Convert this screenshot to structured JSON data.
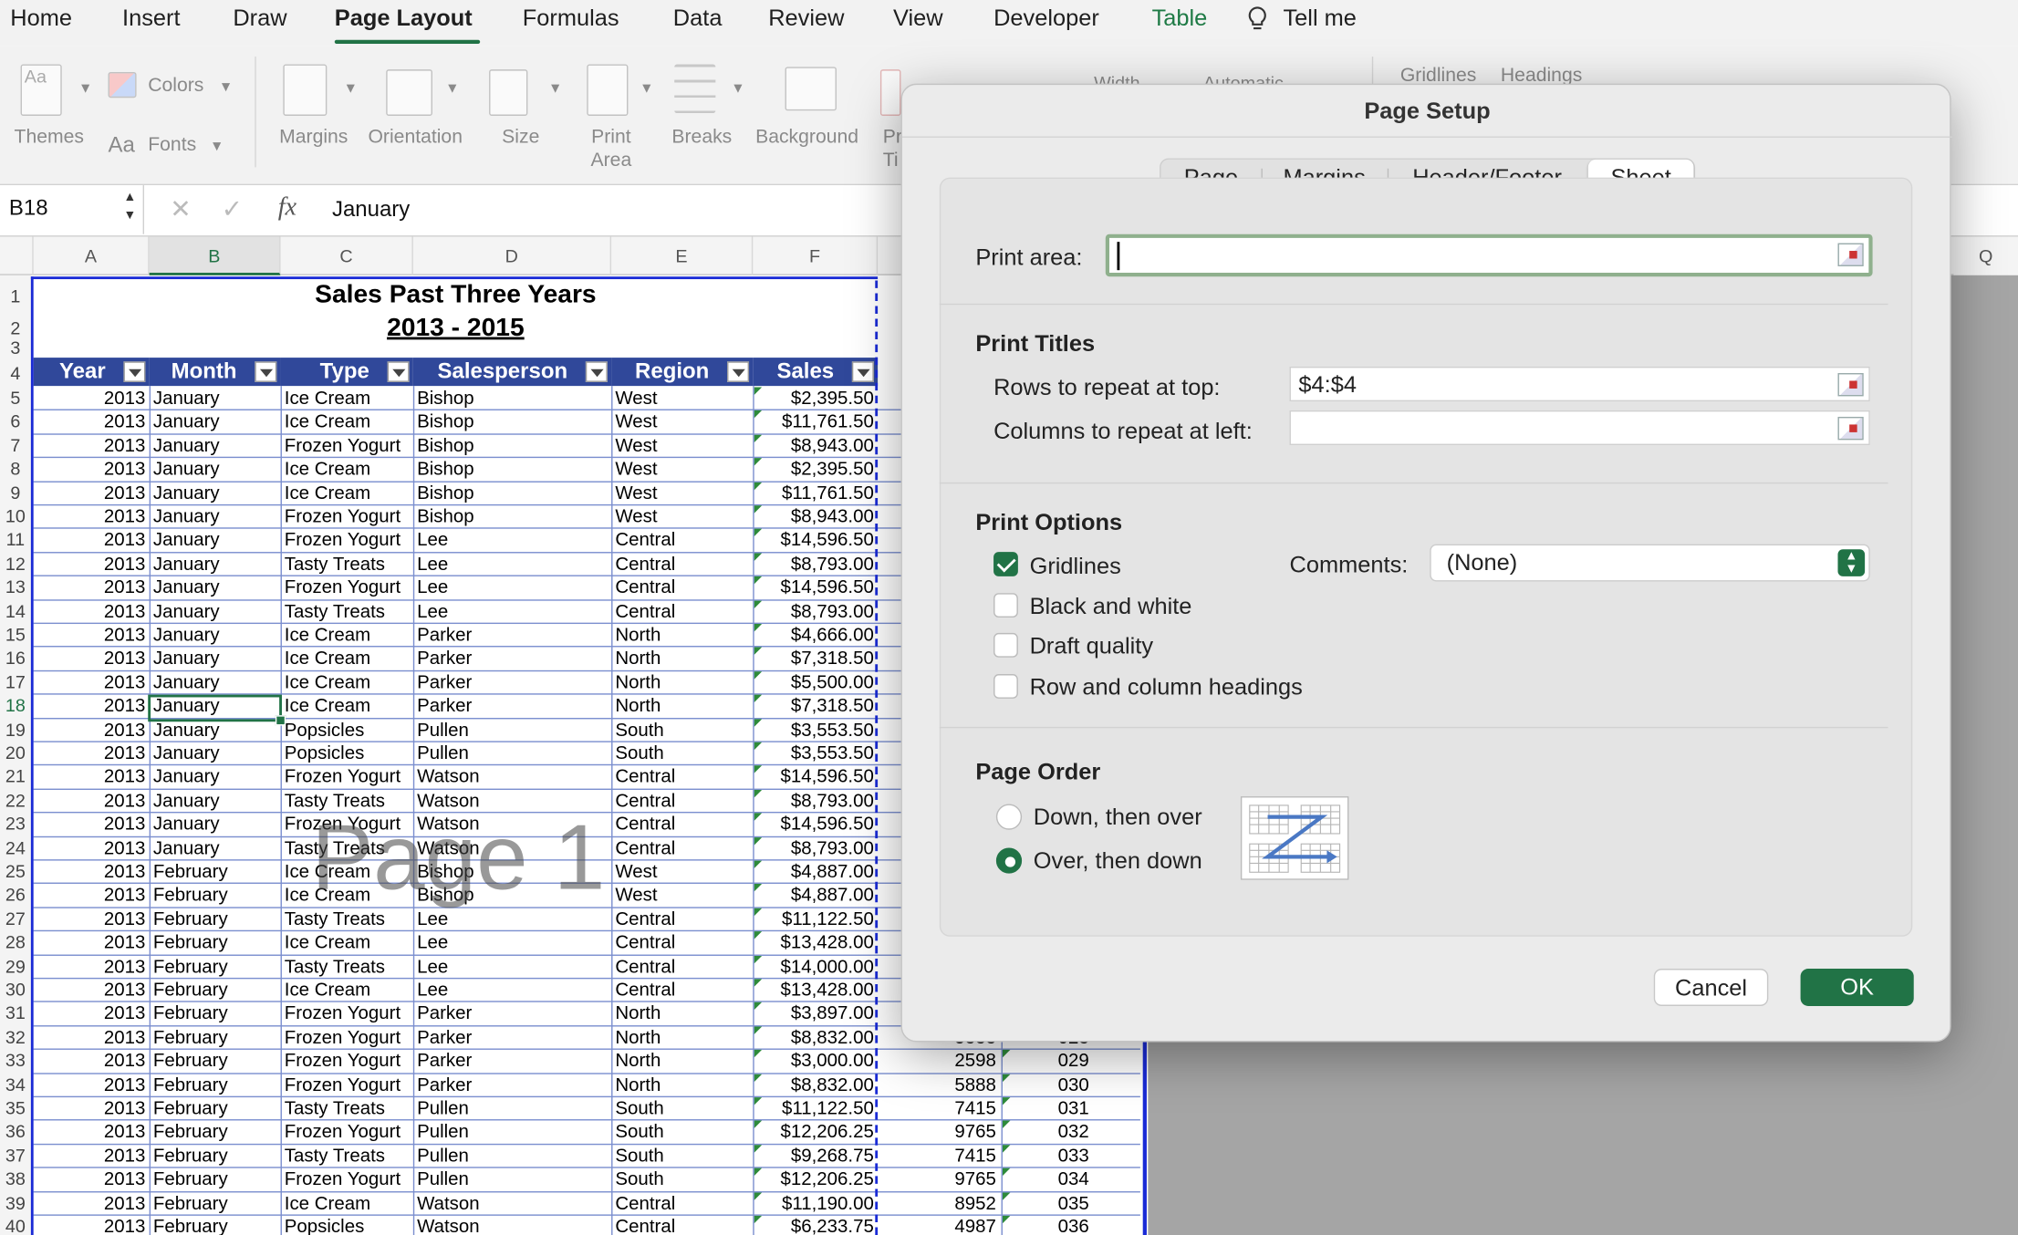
{
  "menu": {
    "tabs": [
      "Home",
      "Insert",
      "Draw",
      "Page Layout",
      "Formulas",
      "Data",
      "Review",
      "View",
      "Developer",
      "Table",
      "Tell me"
    ],
    "active": "Page Layout"
  },
  "ribbon": {
    "themes": "Themes",
    "colors": "Colors",
    "fonts": "Fonts",
    "fonts_glyph": "Aa",
    "margins": "Margins",
    "orientation": "Orientation",
    "size": "Size",
    "print_area": "Print\nArea",
    "breaks": "Breaks",
    "background": "Background",
    "print_titles_partial": "Pr\nTi",
    "width_partial": "Width",
    "automatic_partial": "Automatic",
    "gridlines": "Gridlines",
    "headings": "Headings"
  },
  "formula_bar": {
    "name_box": "B18",
    "cancel_glyph": "✕",
    "enter_glyph": "✓",
    "fx": "fx",
    "content": "January"
  },
  "columns": [
    "A",
    "B",
    "C",
    "D",
    "E",
    "F",
    "Q"
  ],
  "selected_column": "B",
  "selected_row": 18,
  "sheet": {
    "title": "Sales Past Three Years",
    "subtitle": "2013 - 2015",
    "headers": [
      "Year",
      "Month",
      "Type",
      "Salesperson",
      "Region",
      "Sales"
    ],
    "watermark": "Page 1",
    "rows": [
      [
        "2013",
        "January",
        "Ice Cream",
        "Bishop",
        "West",
        "$2,395.50"
      ],
      [
        "2013",
        "January",
        "Ice Cream",
        "Bishop",
        "West",
        "$11,761.50"
      ],
      [
        "2013",
        "January",
        "Frozen Yogurt",
        "Bishop",
        "West",
        "$8,943.00"
      ],
      [
        "2013",
        "January",
        "Ice Cream",
        "Bishop",
        "West",
        "$2,395.50"
      ],
      [
        "2013",
        "January",
        "Ice Cream",
        "Bishop",
        "West",
        "$11,761.50"
      ],
      [
        "2013",
        "January",
        "Frozen Yogurt",
        "Bishop",
        "West",
        "$8,943.00"
      ],
      [
        "2013",
        "January",
        "Frozen Yogurt",
        "Lee",
        "Central",
        "$14,596.50"
      ],
      [
        "2013",
        "January",
        "Tasty Treats",
        "Lee",
        "Central",
        "$8,793.00"
      ],
      [
        "2013",
        "January",
        "Frozen Yogurt",
        "Lee",
        "Central",
        "$14,596.50"
      ],
      [
        "2013",
        "January",
        "Tasty Treats",
        "Lee",
        "Central",
        "$8,793.00"
      ],
      [
        "2013",
        "January",
        "Ice Cream",
        "Parker",
        "North",
        "$4,666.00"
      ],
      [
        "2013",
        "January",
        "Ice Cream",
        "Parker",
        "North",
        "$7,318.50"
      ],
      [
        "2013",
        "January",
        "Ice Cream",
        "Parker",
        "North",
        "$5,500.00"
      ],
      [
        "2013",
        "January",
        "Ice Cream",
        "Parker",
        "North",
        "$7,318.50"
      ],
      [
        "2013",
        "January",
        "Popsicles",
        "Pullen",
        "South",
        "$3,553.50"
      ],
      [
        "2013",
        "January",
        "Popsicles",
        "Pullen",
        "South",
        "$3,553.50"
      ],
      [
        "2013",
        "January",
        "Frozen Yogurt",
        "Watson",
        "Central",
        "$14,596.50"
      ],
      [
        "2013",
        "January",
        "Tasty Treats",
        "Watson",
        "Central",
        "$8,793.00"
      ],
      [
        "2013",
        "January",
        "Frozen Yogurt",
        "Watson",
        "Central",
        "$14,596.50"
      ],
      [
        "2013",
        "January",
        "Tasty Treats",
        "Watson",
        "Central",
        "$8,793.00"
      ],
      [
        "2013",
        "February",
        "Ice Cream",
        "Bishop",
        "West",
        "$4,887.00"
      ],
      [
        "2013",
        "February",
        "Ice Cream",
        "Bishop",
        "West",
        "$4,887.00"
      ],
      [
        "2013",
        "February",
        "Tasty Treats",
        "Lee",
        "Central",
        "$11,122.50"
      ],
      [
        "2013",
        "February",
        "Ice Cream",
        "Lee",
        "Central",
        "$13,428.00"
      ],
      [
        "2013",
        "February",
        "Tasty Treats",
        "Lee",
        "Central",
        "$14,000.00"
      ],
      [
        "2013",
        "February",
        "Ice Cream",
        "Lee",
        "Central",
        "$13,428.00"
      ],
      [
        "2013",
        "February",
        "Frozen Yogurt",
        "Parker",
        "North",
        "$3,897.00"
      ],
      [
        "2013",
        "February",
        "Frozen Yogurt",
        "Parker",
        "North",
        "$8,832.00"
      ],
      [
        "2013",
        "February",
        "Frozen Yogurt",
        "Parker",
        "North",
        "$3,000.00"
      ],
      [
        "2013",
        "February",
        "Frozen Yogurt",
        "Parker",
        "North",
        "$8,832.00"
      ],
      [
        "2013",
        "February",
        "Tasty Treats",
        "Pullen",
        "South",
        "$11,122.50"
      ],
      [
        "2013",
        "February",
        "Frozen Yogurt",
        "Pullen",
        "South",
        "$12,206.25"
      ],
      [
        "2013",
        "February",
        "Tasty Treats",
        "Pullen",
        "South",
        "$9,268.75"
      ],
      [
        "2013",
        "February",
        "Frozen Yogurt",
        "Pullen",
        "South",
        "$12,206.25"
      ],
      [
        "2013",
        "February",
        "Ice Cream",
        "Watson",
        "Central",
        "$11,190.00"
      ],
      [
        "2013",
        "February",
        "Popsicles",
        "Watson",
        "Central",
        "$6,233.75"
      ]
    ],
    "extra_visible": [
      {
        "row": 32,
        "g": "5888",
        "h": "028"
      },
      {
        "row": 33,
        "g": "2598",
        "h": "029"
      },
      {
        "row": 34,
        "g": "5888",
        "h": "030"
      },
      {
        "row": 35,
        "g": "7415",
        "h": "031"
      },
      {
        "row": 36,
        "g": "9765",
        "h": "032"
      },
      {
        "row": 37,
        "g": "7415",
        "h": "033"
      },
      {
        "row": 38,
        "g": "9765",
        "h": "034"
      },
      {
        "row": 39,
        "g": "8952",
        "h": "035"
      },
      {
        "row": 40,
        "g": "4987",
        "h": "036"
      }
    ]
  },
  "dialog": {
    "title": "Page Setup",
    "tabs": [
      "Page",
      "Margins",
      "Header/Footer",
      "Sheet"
    ],
    "active_tab": "Sheet",
    "print_area_label": "Print area:",
    "print_area_value": "",
    "print_titles_heading": "Print Titles",
    "rows_repeat_label": "Rows to repeat at top:",
    "rows_repeat_value": "$4:$4",
    "cols_repeat_label": "Columns to repeat at left:",
    "cols_repeat_value": "",
    "print_options_heading": "Print Options",
    "options": [
      {
        "label": "Gridlines",
        "checked": true
      },
      {
        "label": "Black and white",
        "checked": false
      },
      {
        "label": "Draft quality",
        "checked": false
      },
      {
        "label": "Row and column headings",
        "checked": false
      }
    ],
    "comments_label": "Comments:",
    "comments_value": "(None)",
    "page_order_heading": "Page Order",
    "page_order_options": [
      {
        "label": "Down, then over",
        "selected": false
      },
      {
        "label": "Over, then down",
        "selected": true
      }
    ],
    "cancel": "Cancel",
    "ok": "OK"
  },
  "colors": {
    "accent": "#217346",
    "table_header": "#30489a",
    "page_break": "#1a2bd6"
  }
}
